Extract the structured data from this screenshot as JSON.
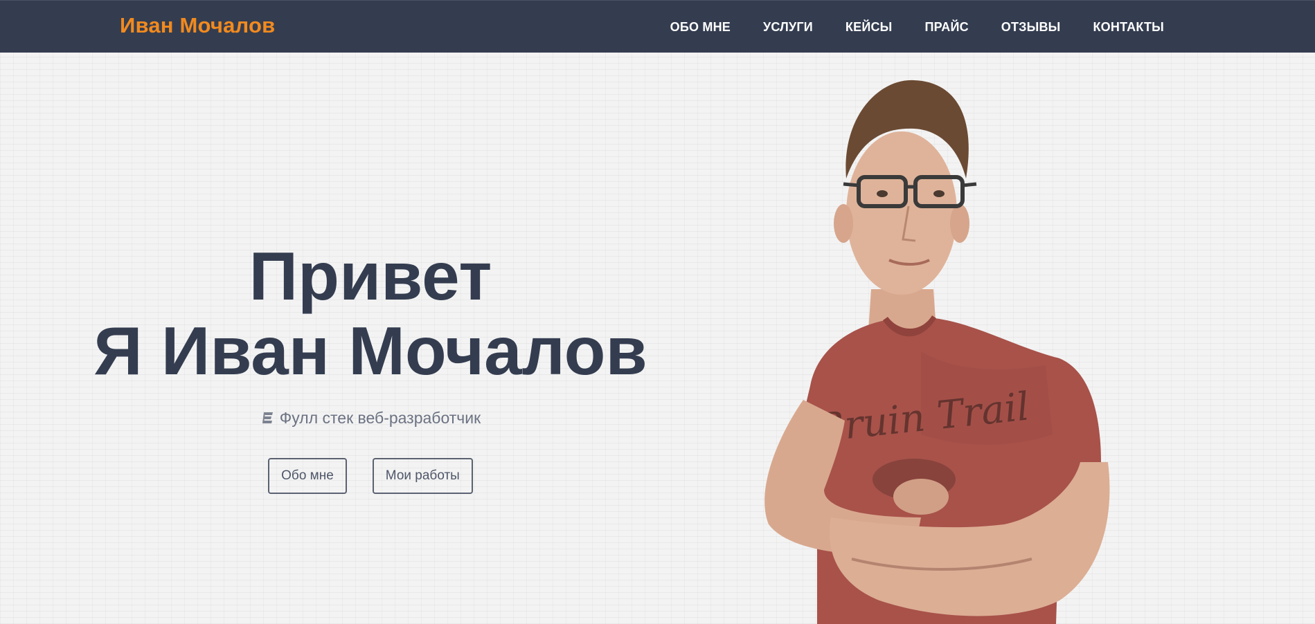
{
  "header": {
    "brand": "Иван Мочалов",
    "nav": [
      "ОБО МНЕ",
      "УСЛУГИ",
      "КЕЙСЫ",
      "ПРАЙС",
      "ОТЗЫВЫ",
      "КОНТАКТЫ"
    ]
  },
  "hero": {
    "title_line1": "Привет",
    "title_line2": "Я Иван Мочалов",
    "subtitle": "Фулл стек веб-разработчик",
    "subtitle_icon": "elementor-icon",
    "buttons": {
      "about": "Обо мне",
      "works": "Мои работы"
    },
    "shirt_text": "Bruin Trail"
  },
  "colors": {
    "navbar": "#343d50",
    "brand": "#f28a1e",
    "title": "#343d50",
    "subtitle": "#6b7282",
    "shirt": "#a8524a"
  }
}
